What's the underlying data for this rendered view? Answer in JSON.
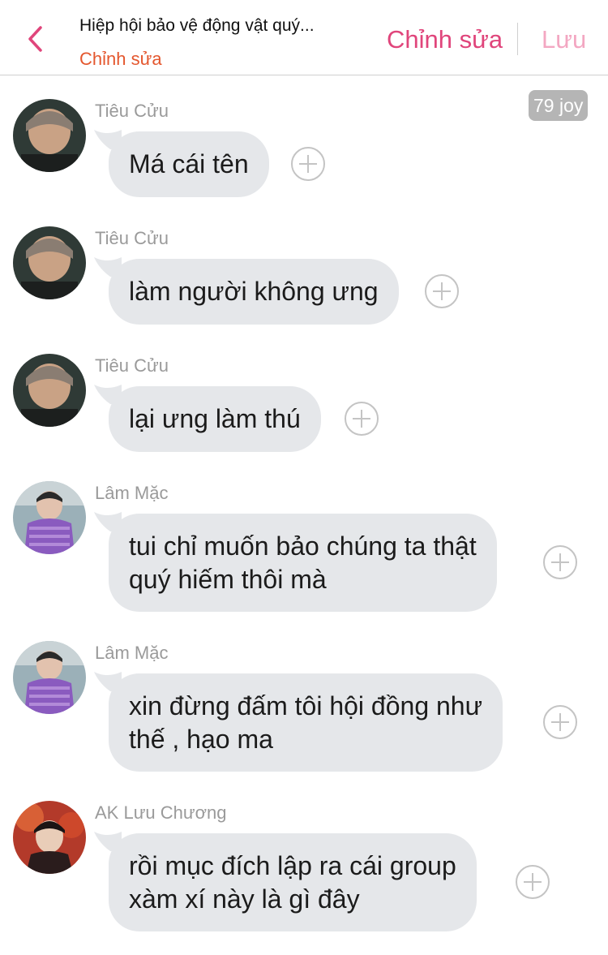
{
  "header": {
    "title": "Hiệp hội bảo vệ động vật quý...",
    "subtitle": "Chỉnh sửa",
    "edit_label": "Chỉnh sửa",
    "save_label": "Lưu"
  },
  "badge": {
    "label": "79 joy"
  },
  "messages": [
    {
      "sender": "Tiêu Cửu",
      "text": "Má cái tên",
      "avatar": "avatar-tieu-cuu"
    },
    {
      "sender": "Tiêu Cửu",
      "text": "làm người không ưng",
      "avatar": "avatar-tieu-cuu"
    },
    {
      "sender": "Tiêu Cửu",
      "text": "lại ưng làm thú",
      "avatar": "avatar-tieu-cuu"
    },
    {
      "sender": "Lâm Mặc",
      "text": "tui chỉ muốn bảo chúng ta thật\nquý hiếm thôi mà",
      "avatar": "avatar-lam-mac"
    },
    {
      "sender": "Lâm Mặc",
      "text": "xin đừng đấm tôi hội đồng như\nthế , hạo ma",
      "avatar": "avatar-lam-mac"
    },
    {
      "sender": "AK Lưu Chương",
      "text": "rồi mục đích lập ra cái group\nxàm xí này là gì đây",
      "avatar": "avatar-ak-luu-chuong"
    }
  ],
  "colors": {
    "accent": "#e0457b",
    "accent_light": "#f3a7c2",
    "subtitle": "#e4572e",
    "bubble": "#e5e7ea",
    "badge": "#b5b5b5"
  },
  "icons": {
    "back": "chevron-left-icon",
    "add_reaction": "plus-circle-icon"
  }
}
